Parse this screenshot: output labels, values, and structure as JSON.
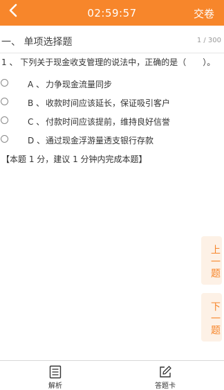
{
  "header": {
    "timer": "02:59:57",
    "submit_label": "交卷"
  },
  "section": {
    "title": "一、 单项选择题",
    "count": "1 / 300"
  },
  "question": {
    "text": "1 、 下列关于现金收支管理的说法中，正确的是（　　）。",
    "options": [
      {
        "letter": "A 、",
        "text": "力争现金流量同步"
      },
      {
        "letter": "B 、",
        "text": "收款时间应该延长，保证吸引客户"
      },
      {
        "letter": "C 、",
        "text": "付款时间应该提前，维持良好信誉"
      },
      {
        "letter": "D 、",
        "text": "通过现金浮游量透支银行存款"
      }
    ],
    "hint": "【本题 1 分，建议 1 分钟内完成本题】"
  },
  "side_buttons": {
    "prev": "上一题",
    "next": "下一题"
  },
  "bottom_tabs": {
    "analysis": "解析",
    "answer_card": "答题卡"
  },
  "colors": {
    "accent": "#f7862b"
  }
}
